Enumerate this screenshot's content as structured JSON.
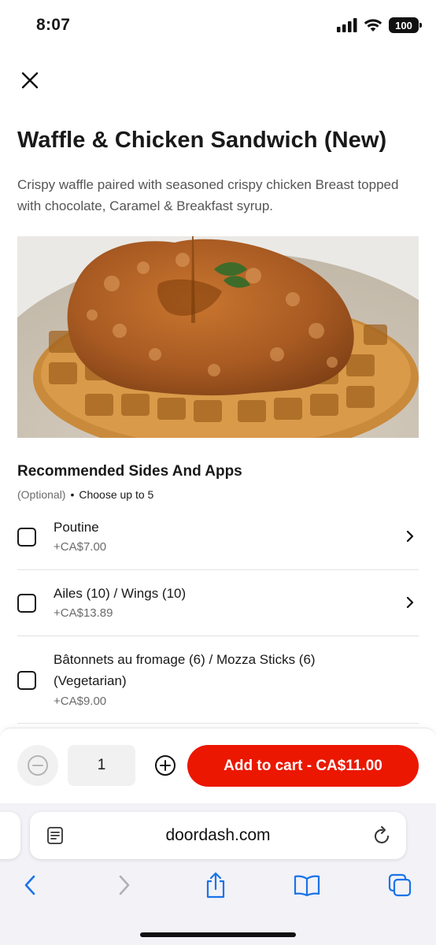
{
  "status_bar": {
    "time": "8:07",
    "battery": "100"
  },
  "item": {
    "title": "Waffle & Chicken Sandwich (New)",
    "description": "Crispy waffle paired with seasoned crispy chicken Breast topped with chocolate, Caramel & Breakfast syrup."
  },
  "options_section": {
    "title": "Recommended Sides And Apps",
    "optional_label": "(Optional)",
    "separator": "•",
    "limit_label": "Choose up to 5",
    "items": [
      {
        "name": "Poutine",
        "price": "+CA$7.00",
        "checked": false,
        "has_chevron": true
      },
      {
        "name": "Ailes (10) / Wings (10)",
        "price": "+CA$13.89",
        "checked": false,
        "has_chevron": true
      },
      {
        "name": "Bâtonnets au fromage (6) / Mozza Sticks (6) (Vegetarian)",
        "price": "+CA$9.00",
        "checked": false,
        "has_chevron": false
      }
    ]
  },
  "cart_bar": {
    "quantity": "1",
    "add_button_label": "Add to cart - CA$11.00",
    "accent_color": "#eb1700"
  },
  "browser": {
    "url": "doordash.com"
  },
  "icons": {
    "close": "close-icon",
    "minus": "minus-circle-icon",
    "plus": "plus-circle-icon",
    "chevron": "chevron-right-icon",
    "reader": "reader-icon",
    "reload": "reload-icon",
    "back": "back-arrow-icon",
    "forward": "forward-arrow-icon",
    "share": "share-icon",
    "bookmarks": "bookmarks-icon",
    "tabs": "tabs-icon"
  }
}
